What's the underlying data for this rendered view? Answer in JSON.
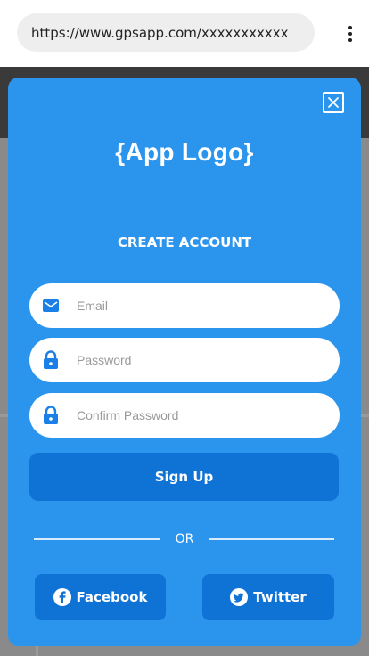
{
  "browser": {
    "url": "https://www.gpsapp.com/xxxxxxxxxxx"
  },
  "modal": {
    "logo": "{App Logo}",
    "heading": "CREATE ACCOUNT",
    "fields": {
      "email_placeholder": "Email",
      "password_placeholder": "Password",
      "confirm_placeholder": "Confirm Password"
    },
    "signup_label": "Sign Up",
    "or_label": "OR",
    "facebook_label": "Facebook",
    "twitter_label": "Twitter"
  },
  "colors": {
    "modal_bg": "#2b95ee",
    "button_bg": "#0f73d6",
    "field_icon": "#1a7fe6"
  },
  "icons": [
    "menu-dots-icon",
    "close-icon",
    "mail-icon",
    "lock-icon",
    "facebook-icon",
    "twitter-icon"
  ]
}
